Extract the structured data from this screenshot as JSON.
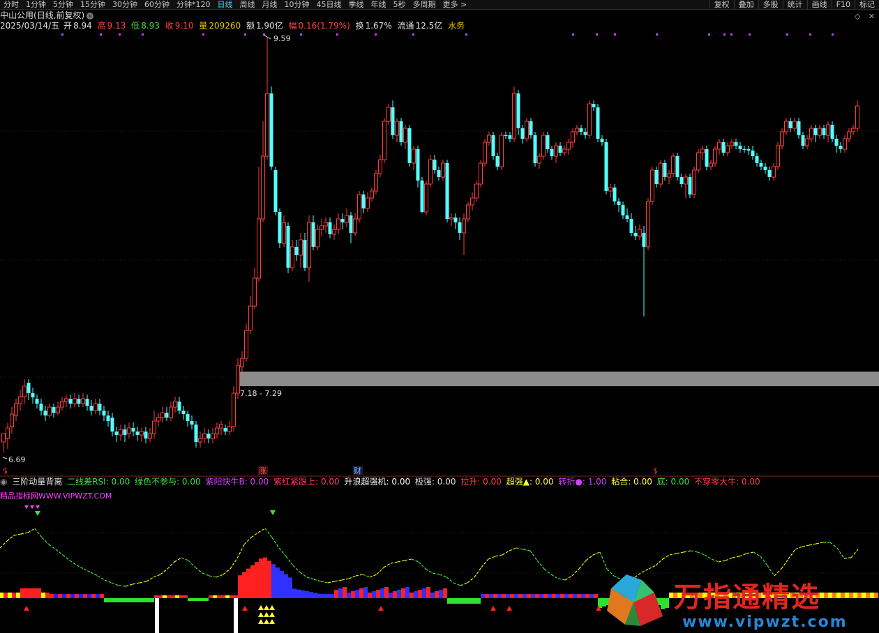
{
  "toolbar": {
    "timeframes": [
      "分时",
      "1分钟",
      "5分钟",
      "15分钟",
      "30分钟",
      "60分钟",
      "分钟*120",
      "日线",
      "周线",
      "月线",
      "10分钟",
      "45日线",
      "季线",
      "年线",
      "5秒",
      "多周期",
      "更多 >"
    ],
    "active_index": 7,
    "right_buttons": [
      "复权",
      "叠加",
      "多股",
      "统计",
      "画线",
      "F10",
      "标记"
    ]
  },
  "stock": {
    "name": "中山公用",
    "mode": "(日线,前复权)"
  },
  "quote": {
    "date": "2025/03/14/五",
    "open_label": "开",
    "open": "8.94",
    "high_label": "高",
    "high": "9.13",
    "low_label": "低",
    "low": "8.93",
    "close_label": "收",
    "close": "9.10",
    "vol_label": "量",
    "vol": "209260",
    "amount_label": "额",
    "amount": "1.90亿",
    "chg_label": "幅",
    "chg": "0.16(1.79%)",
    "turnover_label": "换",
    "turnover": "1.67%",
    "float_label": "流通",
    "float": "12.5亿",
    "sector": "水务"
  },
  "annotations": {
    "high_price": "9.59",
    "low_price": "6.69",
    "gap_zone": "7.18 - 7.29",
    "marker_zhang": "涨",
    "marker_cai": "财",
    "marker_s": "$"
  },
  "indicator": {
    "name": "三阶动量背离",
    "items": [
      {
        "label": "二线差RSI: 0.00",
        "color": "#40e040"
      },
      {
        "label": "绿色不参与: 0.00",
        "color": "#40e040"
      },
      {
        "label": "紫阳快牛B: 0.00",
        "color": "#d040ff"
      },
      {
        "label": "紫红紧跟上: 0.00",
        "color": "#ff4060"
      },
      {
        "label": "升浪超强机: 0.00",
        "color": "#ffffff"
      },
      {
        "label": "极强: 0.00",
        "color": "#e0e0e0"
      },
      {
        "label": "拉升: 0.00",
        "color": "#ff4040"
      },
      {
        "label": "超强▲: 0.00",
        "color": "#ffff40"
      },
      {
        "label": "转折●: 1.00",
        "color": "#d040ff"
      },
      {
        "label": "粘合: 0.00",
        "color": "#ffff40"
      },
      {
        "label": "底: 0.00",
        "color": "#40e040"
      },
      {
        "label": "不穿零大牛: 0.00",
        "color": "#ff4040"
      }
    ],
    "site": "精品指标网WWW.VIPWZT.COM"
  },
  "watermark": {
    "title": "万指通精选",
    "url": "www.vipwzt.com"
  },
  "colors": {
    "up": "#ff3c3c",
    "down": "#54ffff",
    "gap": "#8c8c8c",
    "accent": "#4fd0ff"
  }
}
